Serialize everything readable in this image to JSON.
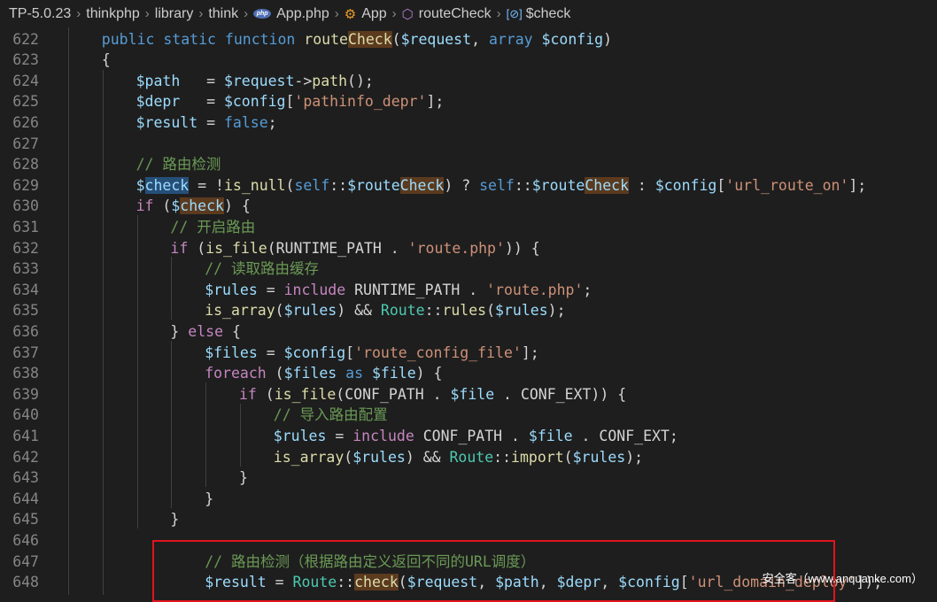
{
  "breadcrumb": {
    "items": [
      "TP-5.0.23",
      "thinkphp",
      "library",
      "think",
      "App.php",
      "App",
      "routeCheck",
      "$check"
    ],
    "php_icon_text": "php"
  },
  "editor": {
    "lines": [
      {
        "n": "622",
        "tokens": [
          [
            "kw",
            "public "
          ],
          [
            "kw",
            "static "
          ],
          [
            "kw",
            "function "
          ],
          [
            "fn",
            "route"
          ],
          [
            "fn hl",
            "Check"
          ],
          [
            "",
            "("
          ],
          [
            "var",
            "$request"
          ],
          [
            "",
            ", "
          ],
          [
            "kw",
            "array "
          ],
          [
            "var",
            "$config"
          ],
          [
            "",
            ")"
          ]
        ]
      },
      {
        "n": "623",
        "tokens": [
          [
            "",
            "{"
          ]
        ]
      },
      {
        "n": "624",
        "tokens": [
          [
            "var",
            "$path"
          ],
          [
            "",
            "   = "
          ],
          [
            "var",
            "$request"
          ],
          [
            "",
            "->"
          ],
          [
            "fn",
            "path"
          ],
          [
            "",
            "();"
          ]
        ]
      },
      {
        "n": "625",
        "tokens": [
          [
            "var",
            "$depr"
          ],
          [
            "",
            "   = "
          ],
          [
            "var",
            "$config"
          ],
          [
            "",
            "["
          ],
          [
            "str",
            "'pathinfo_depr'"
          ],
          [
            "",
            "];"
          ]
        ]
      },
      {
        "n": "626",
        "tokens": [
          [
            "var",
            "$result"
          ],
          [
            "",
            " = "
          ],
          [
            "kw",
            "false"
          ],
          [
            "",
            ";"
          ]
        ]
      },
      {
        "n": "627",
        "tokens": []
      },
      {
        "n": "628",
        "tokens": [
          [
            "cm",
            "// 路由检测"
          ]
        ]
      },
      {
        "n": "629",
        "tokens": [
          [
            "var",
            "$"
          ],
          [
            "var hl2",
            "check"
          ],
          [
            "",
            " = !"
          ],
          [
            "fn",
            "is_null"
          ],
          [
            "",
            "("
          ],
          [
            "kw",
            "self"
          ],
          [
            "",
            "::"
          ],
          [
            "var",
            "$route"
          ],
          [
            "var hl",
            "Check"
          ],
          [
            "",
            ") ? "
          ],
          [
            "kw",
            "self"
          ],
          [
            "",
            "::"
          ],
          [
            "var",
            "$route"
          ],
          [
            "var hl",
            "Check"
          ],
          [
            "",
            " : "
          ],
          [
            "var",
            "$config"
          ],
          [
            "",
            "["
          ],
          [
            "str",
            "'url_route_on'"
          ],
          [
            "",
            "];"
          ]
        ]
      },
      {
        "n": "630",
        "tokens": [
          [
            "ctl",
            "if"
          ],
          [
            "",
            " ("
          ],
          [
            "var",
            "$"
          ],
          [
            "var hl",
            "check"
          ],
          [
            "",
            ") {"
          ]
        ]
      },
      {
        "n": "631",
        "tokens": [
          [
            "cm",
            "// 开启路由"
          ]
        ]
      },
      {
        "n": "632",
        "tokens": [
          [
            "ctl",
            "if"
          ],
          [
            "",
            " ("
          ],
          [
            "fn",
            "is_file"
          ],
          [
            "",
            "("
          ],
          [
            "const",
            "RUNTIME_PATH"
          ],
          [
            "",
            " . "
          ],
          [
            "str",
            "'route.php'"
          ],
          [
            "",
            ")) {"
          ]
        ]
      },
      {
        "n": "633",
        "tokens": [
          [
            "cm",
            "// 读取路由缓存"
          ]
        ]
      },
      {
        "n": "634",
        "tokens": [
          [
            "var",
            "$rules"
          ],
          [
            "",
            " = "
          ],
          [
            "ctl",
            "include "
          ],
          [
            "const",
            "RUNTIME_PATH"
          ],
          [
            "",
            " . "
          ],
          [
            "str",
            "'route.php'"
          ],
          [
            "",
            ";"
          ]
        ]
      },
      {
        "n": "635",
        "tokens": [
          [
            "fn",
            "is_array"
          ],
          [
            "",
            "("
          ],
          [
            "var",
            "$rules"
          ],
          [
            "",
            ") && "
          ],
          [
            "cls",
            "Route"
          ],
          [
            "",
            "::"
          ],
          [
            "fn",
            "rules"
          ],
          [
            "",
            "("
          ],
          [
            "var",
            "$rules"
          ],
          [
            "",
            ");"
          ]
        ]
      },
      {
        "n": "636",
        "tokens": [
          [
            "",
            "} "
          ],
          [
            "ctl",
            "else"
          ],
          [
            "",
            " {"
          ]
        ]
      },
      {
        "n": "637",
        "tokens": [
          [
            "var",
            "$files"
          ],
          [
            "",
            " = "
          ],
          [
            "var",
            "$config"
          ],
          [
            "",
            "["
          ],
          [
            "str",
            "'route_config_file'"
          ],
          [
            "",
            "];"
          ]
        ]
      },
      {
        "n": "638",
        "tokens": [
          [
            "ctl",
            "foreach"
          ],
          [
            "",
            " ("
          ],
          [
            "var",
            "$files"
          ],
          [
            "",
            " "
          ],
          [
            "kw",
            "as"
          ],
          [
            "",
            " "
          ],
          [
            "var",
            "$file"
          ],
          [
            "",
            ") {"
          ]
        ]
      },
      {
        "n": "639",
        "tokens": [
          [
            "ctl",
            "if"
          ],
          [
            "",
            " ("
          ],
          [
            "fn",
            "is_file"
          ],
          [
            "",
            "("
          ],
          [
            "const",
            "CONF_PATH"
          ],
          [
            "",
            " . "
          ],
          [
            "var",
            "$file"
          ],
          [
            "",
            " . "
          ],
          [
            "const",
            "CONF_EXT"
          ],
          [
            "",
            ")) {"
          ]
        ]
      },
      {
        "n": "640",
        "tokens": [
          [
            "cm",
            "// 导入路由配置"
          ]
        ]
      },
      {
        "n": "641",
        "tokens": [
          [
            "var",
            "$rules"
          ],
          [
            "",
            " = "
          ],
          [
            "ctl",
            "include "
          ],
          [
            "const",
            "CONF_PATH"
          ],
          [
            "",
            " . "
          ],
          [
            "var",
            "$file"
          ],
          [
            "",
            " . "
          ],
          [
            "const",
            "CONF_EXT"
          ],
          [
            "",
            ";"
          ]
        ]
      },
      {
        "n": "642",
        "tokens": [
          [
            "fn",
            "is_array"
          ],
          [
            "",
            "("
          ],
          [
            "var",
            "$rules"
          ],
          [
            "",
            ") && "
          ],
          [
            "cls",
            "Route"
          ],
          [
            "",
            "::"
          ],
          [
            "fn",
            "import"
          ],
          [
            "",
            "("
          ],
          [
            "var",
            "$rules"
          ],
          [
            "",
            ");"
          ]
        ]
      },
      {
        "n": "643",
        "tokens": [
          [
            "",
            "}"
          ]
        ]
      },
      {
        "n": "644",
        "tokens": [
          [
            "",
            "}"
          ]
        ]
      },
      {
        "n": "645",
        "tokens": [
          [
            "",
            "}"
          ]
        ]
      },
      {
        "n": "646",
        "tokens": []
      },
      {
        "n": "647",
        "tokens": [
          [
            "cm",
            "// 路由检测（根据路由定义返回不同的URL调度）"
          ]
        ]
      },
      {
        "n": "648",
        "tokens": [
          [
            "var",
            "$result"
          ],
          [
            "",
            " = "
          ],
          [
            "cls",
            "Route"
          ],
          [
            "",
            "::"
          ],
          [
            "fn hl",
            "check"
          ],
          [
            "",
            "("
          ],
          [
            "var",
            "$request"
          ],
          [
            "",
            ", "
          ],
          [
            "var",
            "$path"
          ],
          [
            "",
            ", "
          ],
          [
            "var",
            "$depr"
          ],
          [
            "",
            ", "
          ],
          [
            "var",
            "$config"
          ],
          [
            "",
            "["
          ],
          [
            "str",
            "'url_domain_deploy'"
          ],
          [
            "",
            "]);"
          ]
        ]
      }
    ]
  },
  "watermark": "安全客（www.anquanke.com）",
  "colors": {
    "background": "#1e1e1e",
    "keyword": "#569cd6",
    "control": "#c586c0",
    "variable": "#9cdcfe",
    "function": "#dcdcaa",
    "string": "#ce9178",
    "comment": "#6a9955",
    "class": "#4ec9b0",
    "annotation_box": "#e0141d"
  }
}
